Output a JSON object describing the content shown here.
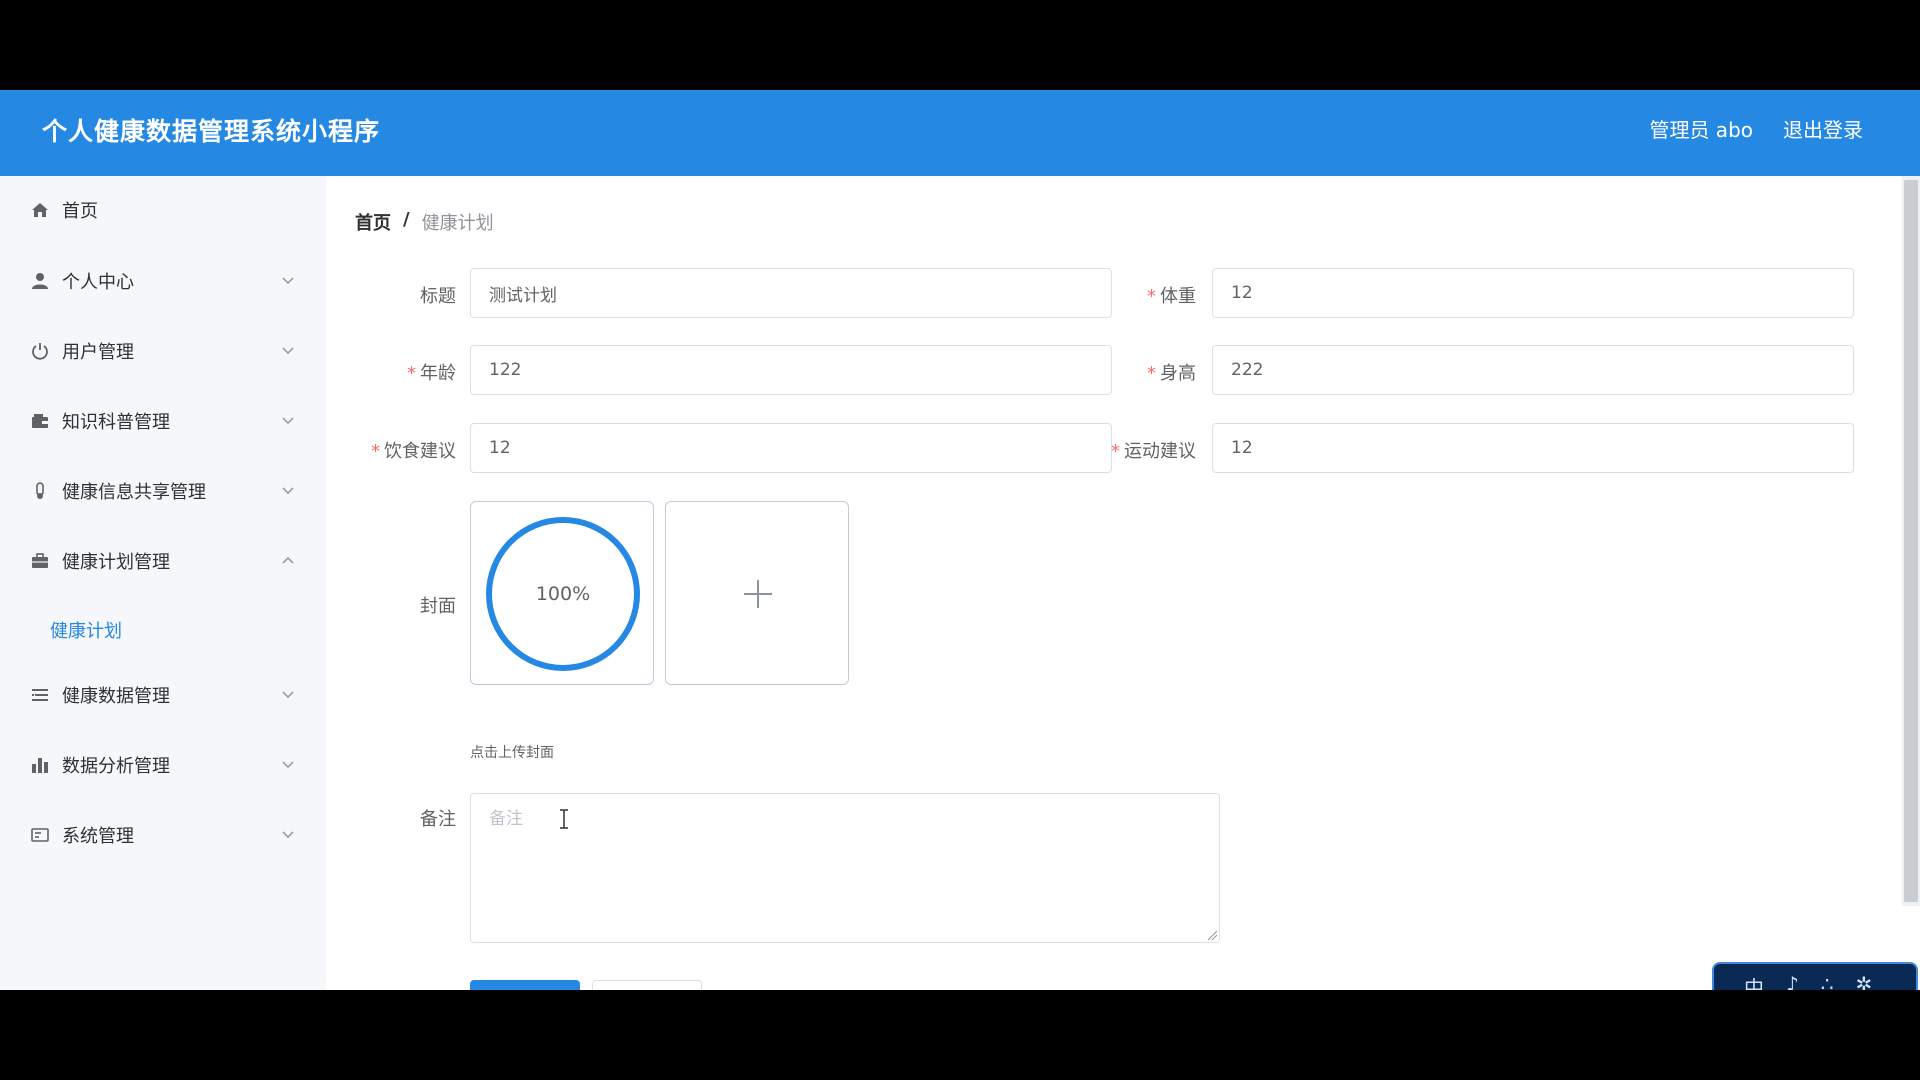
{
  "header": {
    "app_title": "个人健康数据管理系统小程序",
    "user_label": "管理员 abo",
    "logout_label": "退出登录",
    "color": "#2589e3"
  },
  "sidebar": {
    "items": [
      {
        "label": "首页",
        "icon": "home-icon"
      },
      {
        "label": "个人中心",
        "icon": "user-icon"
      },
      {
        "label": "用户管理",
        "icon": "power-icon"
      },
      {
        "label": "知识科普管理",
        "icon": "wallet-icon"
      },
      {
        "label": "健康信息共享管理",
        "icon": "thermometer-icon"
      },
      {
        "label": "健康计划管理",
        "icon": "briefcase-icon"
      },
      {
        "label": "健康数据管理",
        "icon": "list-icon"
      },
      {
        "label": "数据分析管理",
        "icon": "bar-chart-icon"
      },
      {
        "label": "系统管理",
        "icon": "settings-card-icon"
      }
    ],
    "sub_item": "健康计划"
  },
  "breadcrumb": {
    "home": "首页",
    "separator": "/",
    "current": "健康计划"
  },
  "form": {
    "title_label": "标题",
    "title_value": "测试计划",
    "weight_label": "体重",
    "weight_value": "12",
    "age_label": "年龄",
    "age_value": "122",
    "height_label": "身高",
    "height_value": "222",
    "diet_label": "饮食建议",
    "diet_value": "12",
    "exercise_label": "运动建议",
    "exercise_value": "12",
    "cover_label": "封面",
    "upload_progress": "100%",
    "upload_tip": "点击上传封面",
    "remark_label": "备注",
    "remark_placeholder": "备注",
    "required_mark": "*"
  },
  "ime": {
    "mode": "中"
  }
}
